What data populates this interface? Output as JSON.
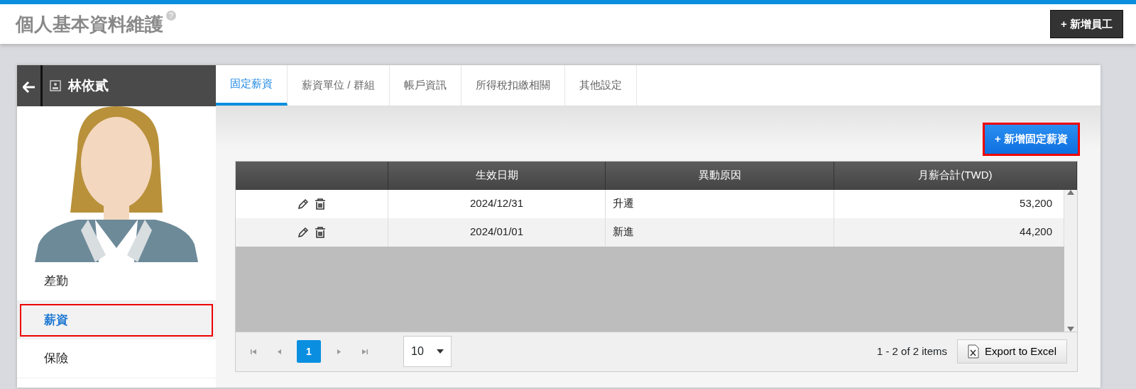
{
  "page": {
    "title": "個人基本資料維護",
    "help": "?",
    "add_employee": "+ 新增員工"
  },
  "employee": {
    "name": "林依貳"
  },
  "sidebar": {
    "items": [
      {
        "label": "差勤",
        "selected": false,
        "highlighted": false
      },
      {
        "label": "薪資",
        "selected": true,
        "highlighted": true
      },
      {
        "label": "保險",
        "selected": false,
        "highlighted": false
      }
    ]
  },
  "tabs": [
    {
      "label": "固定薪資",
      "selected": true
    },
    {
      "label": "薪資單位 / 群組",
      "selected": false
    },
    {
      "label": "帳戶資訊",
      "selected": false
    },
    {
      "label": "所得稅扣繳相關",
      "selected": false
    },
    {
      "label": "其他設定",
      "selected": false
    }
  ],
  "add_button": {
    "label": "+ 新增固定薪資",
    "highlighted": true
  },
  "table": {
    "columns": [
      "",
      "生效日期",
      "異動原因",
      "月薪合計(TWD)"
    ],
    "rows": [
      {
        "date": "2024/12/31",
        "reason": "升遷",
        "total": "53,200"
      },
      {
        "date": "2024/01/01",
        "reason": "新進",
        "total": "44,200"
      }
    ]
  },
  "pager": {
    "pages": [
      {
        "label": "1",
        "selected": true
      }
    ],
    "page_size": "10",
    "summary": "1 - 2 of 2 items",
    "export": "Export to Excel"
  }
}
